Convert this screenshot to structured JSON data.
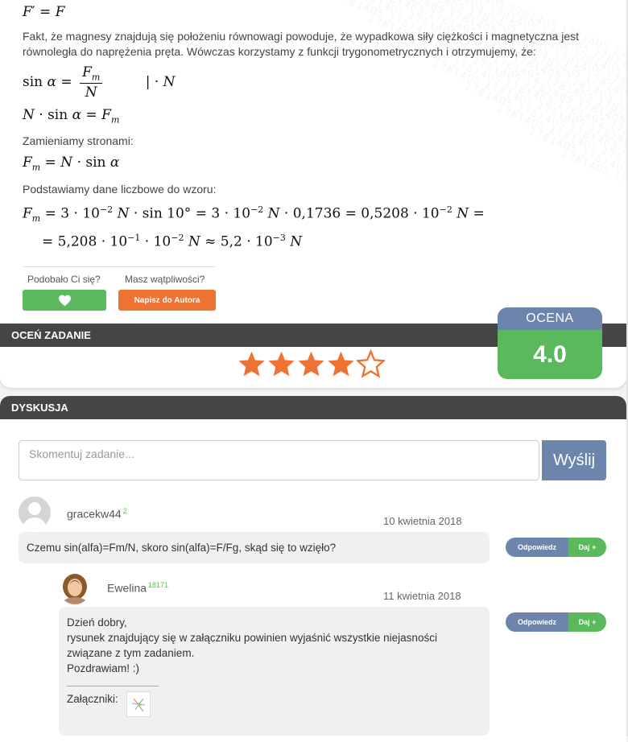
{
  "solution": {
    "eq_top": "F′ = F",
    "para1": "Fakt, że magnesy znajdują się położeniu równowagi powoduje, że wypadkowa siły ciężkości i magnetyczna jest równoległa do naprężenia pręta. Wówczas korzystamy z funkcji trygonometrycznych i otrzymujemy, że:",
    "eq_sin_lhs": "sin α =",
    "eq_sin_num": "Fm",
    "eq_sin_den": "N",
    "eq_sin_mult": "| · N",
    "eq_n_sin": "N · sin α = Fm",
    "para2": "Zamieniamy stronami:",
    "eq_swap": "Fm = N · sin α",
    "para3": "Podstawiamy dane liczbowe do wzoru:",
    "eq_calc1": "Fm = 3 · 10−2 N · sin 10° = 3 · 10−2 N · 0,1736 = 0,5208 · 10−2 N =",
    "eq_calc2": "= 5,208 · 10−1 · 10−2 N ≈ 5,2 · 10−3 N",
    "watermark": "1781405 1781405 1781405 1781405 1781405 1781405 1781405 1781405 1781405 1781405 1781405"
  },
  "feedback": {
    "like_question": "Podobało Ci się?",
    "doubt_question": "Masz wątpliwości?",
    "author_button": "Napisz do Autora"
  },
  "rating": {
    "bar_label": "OCEŃ ZADANIE",
    "score_label": "OCENA",
    "score_value": "4.0",
    "stars_filled": 4,
    "stars_total": 5,
    "star_color": "#ee7231"
  },
  "discussion": {
    "bar_label": "DYSKUSJA",
    "input_placeholder": "Skomentuj zadanie...",
    "send_label": "Wyślij",
    "comments": [
      {
        "user": "gracekw44",
        "points": "2",
        "date": "10 kwietnia 2018",
        "text": "Czemu sin(alfa)=Fm/N, skoro sin(alfa)=F/Fg, skąd się to wzięło?",
        "reply_label": "Odpowiedz",
        "give_label": "Daj +"
      },
      {
        "user": "Ewelina",
        "points": "18171",
        "date": "11 kwietnia 2018",
        "lines": [
          "Dzień dobry,",
          "rysunek znajdujący się w załączniku powinien wyjaśnić wszystkie niejasności związane z tym zadaniem.",
          "Pozdrawiam! :)"
        ],
        "attachments_label": "Załączniki:",
        "reply_label": "Odpowiedz",
        "give_label": "Daj +"
      }
    ]
  },
  "colors": {
    "green": "#5cb85c",
    "orange": "#ee7231",
    "blue": "#6d85ad",
    "dark_bar": "#454545"
  }
}
